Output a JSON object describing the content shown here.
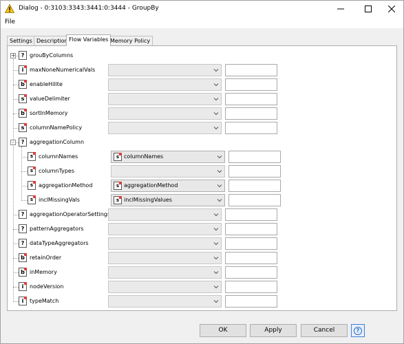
{
  "window": {
    "title": "Dialog - 0:3103:3343:3441:0:3444 - GroupBy"
  },
  "menubar": {
    "file": "File"
  },
  "tabs": [
    {
      "label": "Settings"
    },
    {
      "label": "Description"
    },
    {
      "label": "Flow Variables",
      "active": true
    },
    {
      "label": "Memory Policy"
    }
  ],
  "tree": [
    {
      "name": "grouByColumns",
      "type": "?",
      "expander": "+",
      "level": 0,
      "combo": false
    },
    {
      "name": "maxNoneNumericalVals",
      "type": "i",
      "level": 0,
      "combo": true,
      "selected": ""
    },
    {
      "name": "enableHilite",
      "type": "b",
      "level": 0,
      "combo": true,
      "selected": ""
    },
    {
      "name": "valueDelimiter",
      "type": "s",
      "level": 0,
      "combo": true,
      "selected": ""
    },
    {
      "name": "sortInMemory",
      "type": "b",
      "level": 0,
      "combo": true,
      "selected": ""
    },
    {
      "name": "columnNamePolicy",
      "type": "s",
      "level": 0,
      "combo": true,
      "selected": ""
    },
    {
      "name": "aggregationColumn",
      "type": "?",
      "expander": "-",
      "level": 0,
      "combo": false
    },
    {
      "name": "columnNames",
      "type": "s[]",
      "level": 1,
      "combo": true,
      "selected": "columnNames"
    },
    {
      "name": "columnTypes",
      "type": "s[]",
      "level": 1,
      "combo": true,
      "selected": ""
    },
    {
      "name": "aggregationMethod",
      "type": "s[]",
      "level": 1,
      "combo": true,
      "selected": "aggregationMethod"
    },
    {
      "name": "inclMissingVals",
      "type": "s[]",
      "level": 1,
      "combo": true,
      "selected": "inclMissingValues"
    },
    {
      "name": "aggregationOperatorSettings",
      "type": "?",
      "level": 0,
      "combo": true,
      "selected": ""
    },
    {
      "name": "patternAggregators",
      "type": "?",
      "level": 0,
      "combo": true,
      "selected": ""
    },
    {
      "name": "dataTypeAggregators",
      "type": "?",
      "level": 0,
      "combo": true,
      "selected": ""
    },
    {
      "name": "retainOrder",
      "type": "b",
      "level": 0,
      "combo": true,
      "selected": ""
    },
    {
      "name": "inMemory",
      "type": "b",
      "level": 0,
      "combo": true,
      "selected": ""
    },
    {
      "name": "nodeVersion",
      "type": "i",
      "level": 0,
      "combo": true,
      "selected": ""
    },
    {
      "name": "typeMatch",
      "type": "i",
      "level": 0,
      "combo": true,
      "selected": ""
    }
  ],
  "buttons": {
    "ok": "OK",
    "apply": "Apply",
    "cancel": "Cancel",
    "help": "?"
  },
  "colors": {
    "warning": "#f5c518",
    "flow_variable_dot": "#e03a3a",
    "help_accent": "#2b6fd0"
  }
}
